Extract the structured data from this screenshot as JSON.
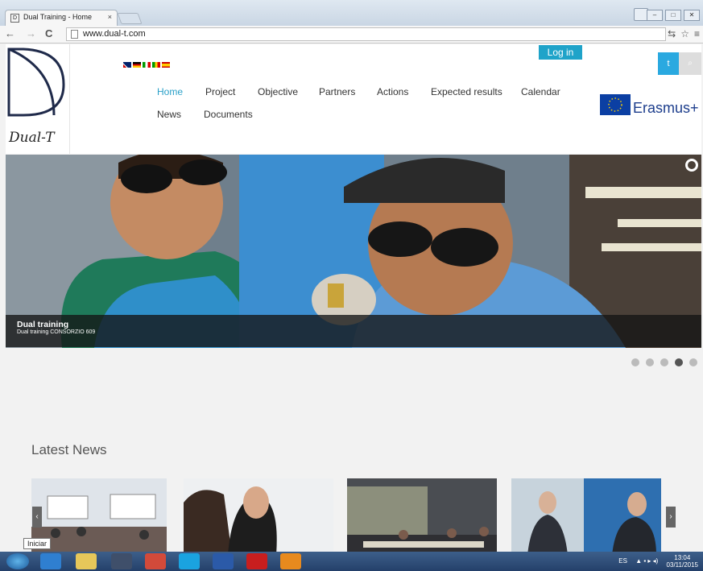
{
  "browser": {
    "tab_title": "Dual Training - Home",
    "tab_close": "×",
    "url": "www.dual-t.com",
    "back": "←",
    "forward": "→",
    "reload": "C"
  },
  "site": {
    "logo_text": "Dual-T",
    "login_label": "Log in",
    "twitter_icon": "twitter-icon",
    "search_icon": "search-icon",
    "erasmus_label": "Erasmus+",
    "nav": [
      {
        "label": "Home",
        "active": true
      },
      {
        "label": "Project"
      },
      {
        "label": "Objective"
      },
      {
        "label": "Partners"
      },
      {
        "label": "Actions"
      },
      {
        "label": "Expected results"
      },
      {
        "label": "Calendar"
      },
      {
        "label": "News"
      },
      {
        "label": "Documents"
      }
    ],
    "languages": [
      "en",
      "de",
      "it",
      "it-alt",
      "es"
    ],
    "accent_color": "#1fa3c9"
  },
  "slider": {
    "caption_title": "Dual training",
    "caption_subtitle": "Dual training CONSORZIO 609",
    "slide_count": 5,
    "active_slide": 4
  },
  "news": {
    "heading": "Latest News",
    "prev": "‹",
    "next": "›"
  },
  "taskbar": {
    "start_tooltip": "Iniciar",
    "lang": "ES",
    "time": "13:04",
    "date": "03/11/2015"
  }
}
